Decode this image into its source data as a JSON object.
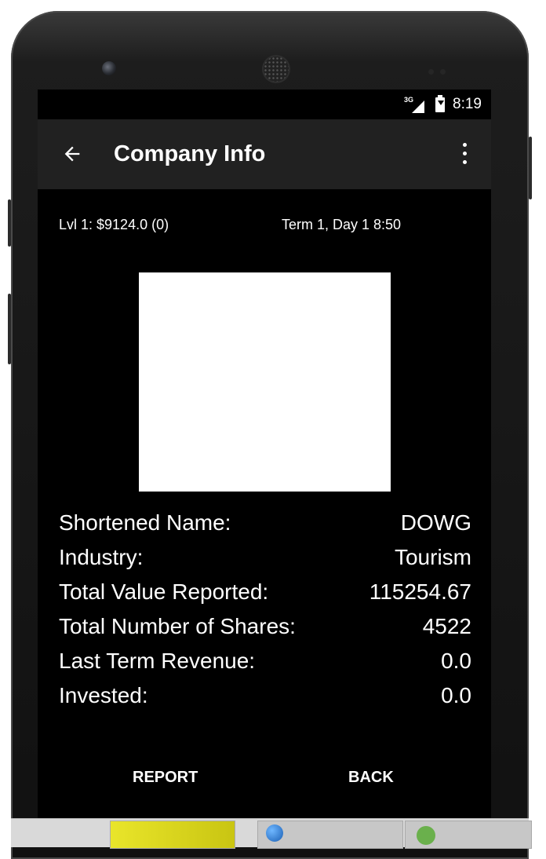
{
  "status_bar": {
    "network": "3G",
    "time": "8:19"
  },
  "app_bar": {
    "title": "Company Info",
    "back_icon": "arrow-left-icon",
    "menu_icon": "more-vert-icon"
  },
  "info": {
    "level_cash": "Lvl 1: $9124.0 (0)",
    "term_day": "Term 1, Day 1  8:50"
  },
  "details": [
    {
      "label": "Shortened Name:",
      "value": "DOWG"
    },
    {
      "label": "Industry:",
      "value": "Tourism"
    },
    {
      "label": "Total Value Reported:",
      "value": "115254.67"
    },
    {
      "label": "Total Number of Shares:",
      "value": "4522"
    },
    {
      "label": "Last Term Revenue:",
      "value": "0.0"
    },
    {
      "label": "Invested:",
      "value": "0.0"
    }
  ],
  "buttons": {
    "report": "REPORT",
    "back": "BACK"
  }
}
